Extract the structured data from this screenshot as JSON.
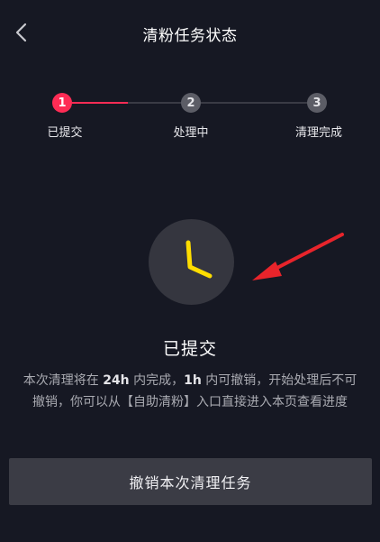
{
  "header": {
    "back_icon": "chevron-left-icon",
    "title": "清粉任务状态"
  },
  "stepper": {
    "steps": [
      {
        "number": "1",
        "label": "已提交",
        "state": "active"
      },
      {
        "number": "2",
        "label": "处理中",
        "state": "pending"
      },
      {
        "number": "3",
        "label": "清理完成",
        "state": "pending"
      }
    ]
  },
  "status": {
    "icon": "clock-icon",
    "title": "已提交",
    "desc_part1": "本次清理将在",
    "desc_bold1": "24h",
    "desc_part2": "内完成，",
    "desc_bold2": "1h",
    "desc_part3": "内可撤销，开始处理后不可撤销，你可以从【自助清粉】入口直接进入本页查看进度"
  },
  "actions": {
    "cancel_label": "撤销本次清理任务"
  },
  "colors": {
    "background": "#161823",
    "accent": "#fe2c55",
    "clock_hand": "#fedd00",
    "button_bg": "#3b3c45",
    "annotation_arrow": "#e8242b"
  }
}
